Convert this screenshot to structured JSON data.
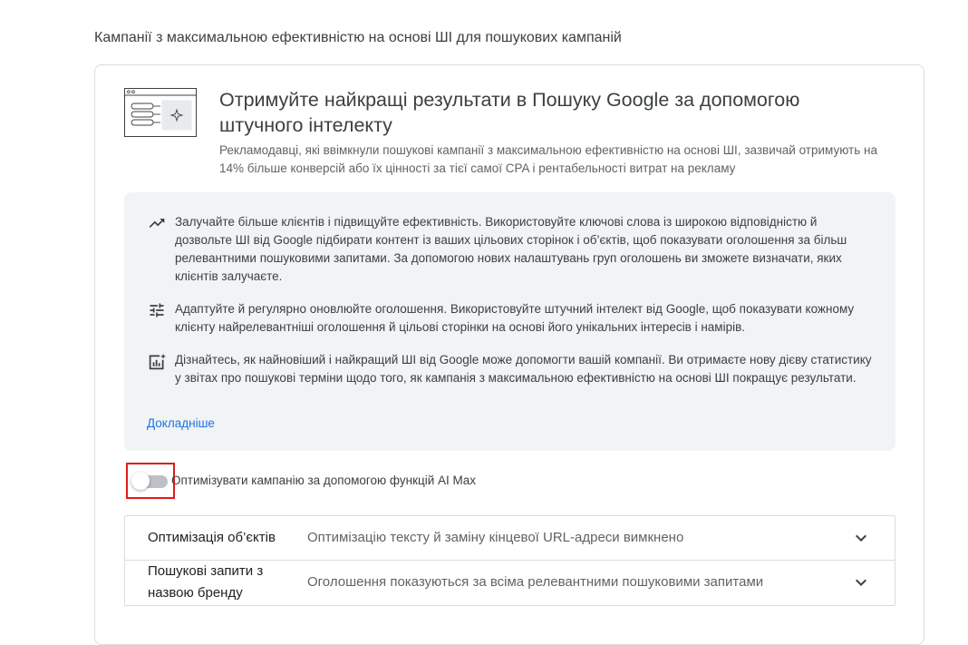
{
  "page": {
    "heading": "Кампанії з максимальною ефективністю на основі ШІ для пошукових кампаній"
  },
  "hero": {
    "title": "Отримуйте найкращі результати в Пошуку Google за допомогою штучного інтелекту",
    "subtitle": "Рекламодавці, які ввімкнули пошукові кампанії з максимальною ефективністю на основі ШІ, зазвичай отримують на 14% більше конверсій або їх цінності за тієї самої CPA і рентабельності витрат на рекламу"
  },
  "benefits": [
    {
      "icon": "trending-up-icon",
      "text": "Залучайте більше клієнтів і підвищуйте ефективність. Використовуйте ключові слова із широкою відповідністю й дозвольте ШІ від Google підбирати контент із ваших цільових сторінок і об’єктів, щоб показувати оголошення за більш релевантними пошуковими запитами. За допомогою нових налаштувань груп оголошень ви зможете визначати, яких клієнтів залучаєте."
    },
    {
      "icon": "tune-icon",
      "text": "Адаптуйте й регулярно оновлюйте оголошення. Використовуйте штучний інтелект від Google, щоб показувати кожному клієнту найрелевантніші оголошення й цільові сторінки на основі його унікальних інтересів і намірів."
    },
    {
      "icon": "insights-icon",
      "text": "Дізнайтесь, як найновіший і найкращий ШІ від Google може допомогти вашій компанії. Ви отримаєте нову дієву статистику у звітах про пошукові терміни щодо того, як кампанія з максимальною ефективністю на основі ШІ покращує результати."
    }
  ],
  "learn_more": "Докладніше",
  "toggle": {
    "label": "Оптимізувати кампанію за допомогою функцій AI Max",
    "enabled": false
  },
  "settings": [
    {
      "name": "Оптимізація об’єктів",
      "value": "Оптимізацію тексту й заміну кінцевої URL-адреси вимкнено"
    },
    {
      "name": "Пошукові запити з назвою бренду",
      "value": "Оголошення показуються за всіма релевантними пошуковими запитами"
    }
  ],
  "colors": {
    "link": "#1a73e8",
    "highlight_border": "#e01b1b",
    "info_bg": "#f1f3f4"
  }
}
